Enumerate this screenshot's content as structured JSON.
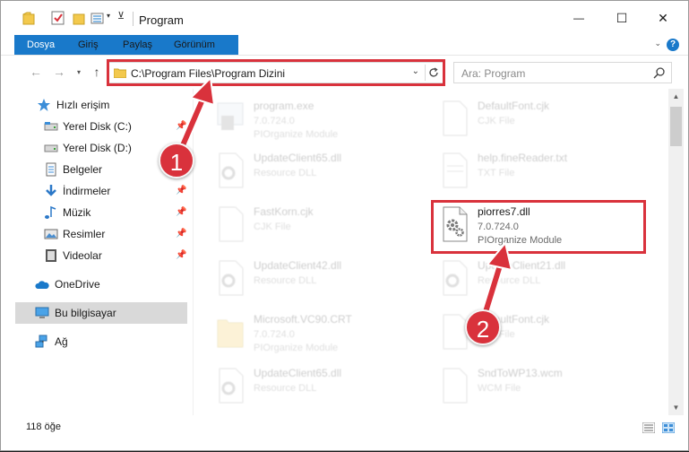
{
  "window": {
    "title": "Program",
    "minimize_label": "—",
    "maximize_label": "☐",
    "close_label": "✕"
  },
  "ribbon": {
    "tabs": [
      {
        "label": "Dosya"
      },
      {
        "label": "Giriş"
      },
      {
        "label": "Paylaş"
      },
      {
        "label": "Görünüm"
      }
    ],
    "help_label": "?"
  },
  "address": {
    "path": "C:\\Program Files\\Program Dizini"
  },
  "search": {
    "placeholder": "Ara: Program"
  },
  "sidebar": {
    "items": [
      {
        "label": "Hızlı erişim",
        "icon": "star-icon"
      },
      {
        "label": "Yerel Disk (C:)",
        "icon": "drive-icon"
      },
      {
        "label": "Yerel Disk (D:)",
        "icon": "drive-icon"
      },
      {
        "label": "Belgeler",
        "icon": "documents-icon"
      },
      {
        "label": "İndirmeler",
        "icon": "download-icon"
      },
      {
        "label": "Müzik",
        "icon": "music-icon"
      },
      {
        "label": "Resimler",
        "icon": "pictures-icon"
      },
      {
        "label": "Videolar",
        "icon": "videos-icon"
      },
      {
        "label": "OneDrive",
        "icon": "cloud-icon"
      },
      {
        "label": "Bu bilgisayar",
        "icon": "computer-icon"
      },
      {
        "label": "Ağ",
        "icon": "network-icon"
      }
    ]
  },
  "files": [
    {
      "name": "program.exe",
      "line1": "7.0.724.0",
      "line2": "PIOrganize Module",
      "icon": "exe-icon"
    },
    {
      "name": "DefaultFont.cjk",
      "line1": "CJK File",
      "line2": "",
      "icon": "blank-file-icon"
    },
    {
      "name": "UpdateClient65.dll",
      "line1": "Resource DLL",
      "line2": "",
      "icon": "dll-icon"
    },
    {
      "name": "help.fineReader.txt",
      "line1": "TXT File",
      "line2": "",
      "icon": "txt-file-icon"
    },
    {
      "name": "FastKorn.cjk",
      "line1": "CJK File",
      "line2": "",
      "icon": "blank-file-icon"
    },
    {
      "name": "piorres7.dll",
      "line1": "7.0.724.0",
      "line2": "PIOrganize Module",
      "icon": "dll-icon"
    },
    {
      "name": "UpdateClient42.dll",
      "line1": "Resource DLL",
      "line2": "",
      "icon": "dll-icon"
    },
    {
      "name": "UpdateClient21.dll",
      "line1": "Resource DLL",
      "line2": "",
      "icon": "dll-icon"
    },
    {
      "name": "Microsoft.VC90.CRT",
      "line1": "7.0.724.0",
      "line2": "PIOrganize Module",
      "icon": "folder-icon"
    },
    {
      "name": "DefaultFont.cjk",
      "line1": "CJK File",
      "line2": "",
      "icon": "blank-file-icon"
    },
    {
      "name": "UpdateClient65.dll",
      "line1": "Resource DLL",
      "line2": "",
      "icon": "dll-icon"
    },
    {
      "name": "SndToWP13.wcm",
      "line1": "WCM File",
      "line2": "",
      "icon": "blank-file-icon"
    }
  ],
  "status": {
    "item_count": "118 öğe"
  },
  "callouts": [
    {
      "number": "1"
    },
    {
      "number": "2"
    }
  ],
  "colors": {
    "accent": "#1979ca",
    "callout_red": "#d9323c"
  }
}
